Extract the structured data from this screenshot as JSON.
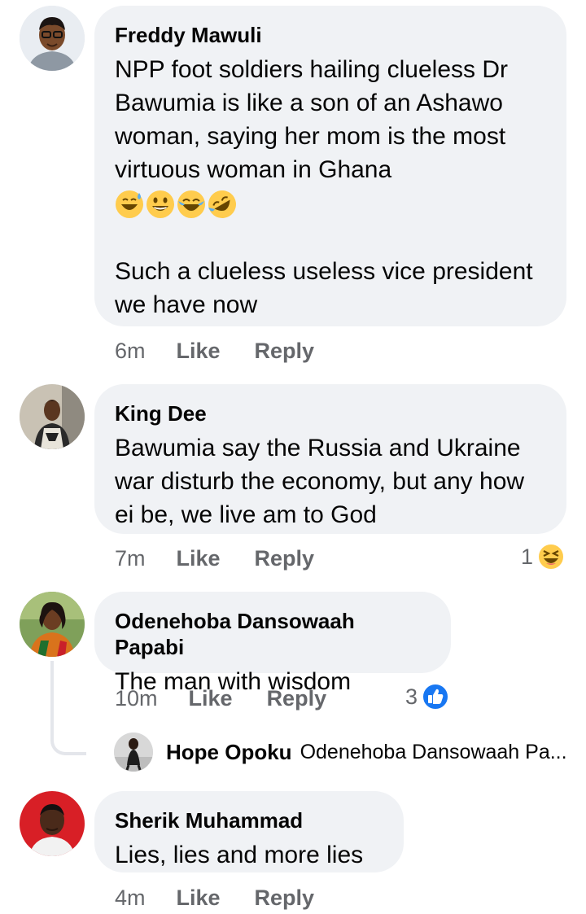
{
  "comments": [
    {
      "author": "Freddy Mawuli",
      "text": "NPP foot soldiers hailing clueless Dr Bawumia is like a son of an Ashawo woman, saying her mom is the most virtuous woman in Ghana",
      "emojis": [
        "sweat-smile-emoji",
        "smile-emoji",
        "laugh-tears-emoji",
        "rofl-emoji"
      ],
      "text2": "Such a clueless useless vice president we have now",
      "time": "6m",
      "like": "Like",
      "reply": "Reply"
    },
    {
      "author": "King Dee",
      "text": "Bawumia say the Russia and Ukraine war disturb the economy, but any how ei be, we live am to God",
      "time": "7m",
      "like": "Like",
      "reply": "Reply",
      "reaction_count": "1",
      "reaction_icon": "haha-emoji"
    },
    {
      "author": "Odenehoba Dansowaah Papabi",
      "text": "The man with wisdom",
      "time": "10m",
      "like": "Like",
      "reply": "Reply",
      "reaction_count": "3",
      "reaction_icon": "like-emoji",
      "reply_preview": {
        "author": "Hope Opoku",
        "text": "Odenehoba Dansowaah Pa..."
      }
    },
    {
      "author": "Sherik Muhammad",
      "text": "Lies, lies and more lies",
      "time": "4m",
      "like": "Like",
      "reply": "Reply"
    }
  ],
  "colors": {
    "bubble": "#f0f2f5",
    "meta": "#65676b",
    "text": "#050505",
    "like_blue": "#1877f2",
    "emoji_yellow": "#ffcc4d"
  }
}
